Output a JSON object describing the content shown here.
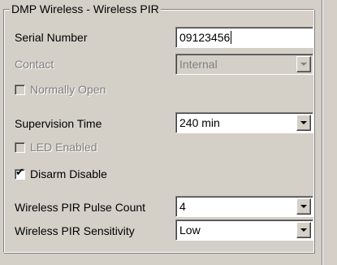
{
  "group_title": "DMP Wireless - Wireless PIR",
  "fields": {
    "serial_number": {
      "label": "Serial Number",
      "value": "09123456"
    },
    "contact": {
      "label": "Contact",
      "value": "Internal"
    },
    "normally_open": {
      "label": "Normally Open",
      "checked": false
    },
    "supervision_time": {
      "label": "Supervision Time",
      "value": "240 min"
    },
    "led_enabled": {
      "label": "LED Enabled",
      "checked": false
    },
    "disarm_disable": {
      "label": "Disarm Disable",
      "checked": true,
      "mark": "✔"
    },
    "pulse_count": {
      "label": "Wireless PIR Pulse Count",
      "value": "4"
    },
    "sensitivity": {
      "label": "Wireless PIR Sensitivity",
      "value": "Low"
    }
  }
}
